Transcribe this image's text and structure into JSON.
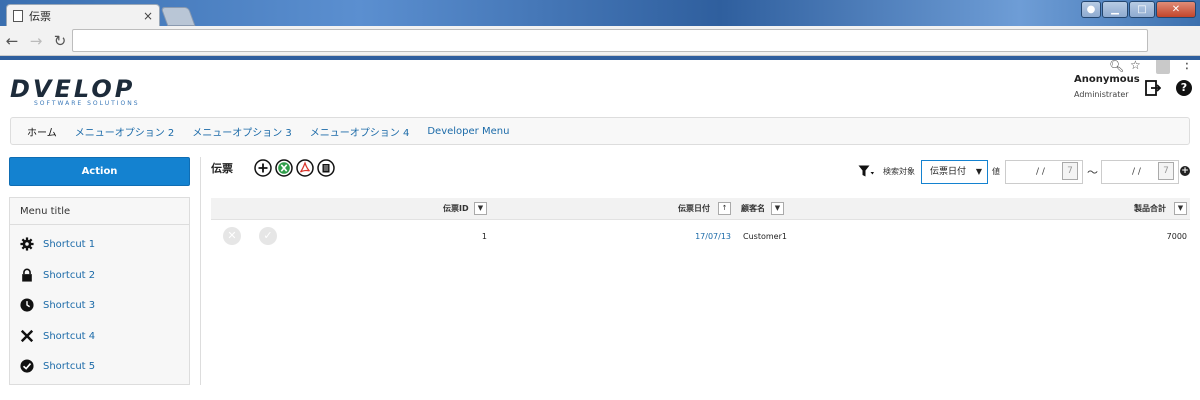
{
  "browser": {
    "tab_title": "伝票",
    "tab_close": "×",
    "url": ""
  },
  "brand": {
    "logo_text": "DVELOP",
    "logo_sub": "SOFTWARE SOLUTIONS"
  },
  "user": {
    "name": "Anonymous",
    "role": "Administrater"
  },
  "menu": [
    {
      "label": "ホーム"
    },
    {
      "label": "メニューオプション 2"
    },
    {
      "label": "メニューオプション 3"
    },
    {
      "label": "メニューオプション 4"
    },
    {
      "label": "Developer Menu"
    }
  ],
  "sidebar": {
    "action_label": "Action",
    "menu_title": "Menu title",
    "shortcuts": [
      {
        "label": "Shortcut 1",
        "icon": "gear-icon"
      },
      {
        "label": "Shortcut 2",
        "icon": "lock-icon"
      },
      {
        "label": "Shortcut 3",
        "icon": "clock-icon"
      },
      {
        "label": "Shortcut 4",
        "icon": "x-icon"
      },
      {
        "label": "Shortcut 5",
        "icon": "check-circle-icon"
      }
    ]
  },
  "page": {
    "title": "伝票",
    "toolbar_icons": [
      "add-circle-icon",
      "excel-icon",
      "pdf-icon",
      "document-icon"
    ]
  },
  "search": {
    "label": "検索対象",
    "selected": "伝票日付",
    "value_label": "値",
    "date_from": "/ /",
    "date_to": "/ /",
    "tilde": "～"
  },
  "grid": {
    "columns": [
      {
        "label": "伝票ID"
      },
      {
        "label": "伝票日付"
      },
      {
        "label": "顧客名"
      },
      {
        "label": "製品合計"
      }
    ],
    "rows": [
      {
        "id": "1",
        "date": "17/07/13",
        "customer": "Customer1",
        "total": "7000"
      }
    ]
  },
  "colors": {
    "accent": "#1482d0",
    "link": "#1b6aa8",
    "browser_blue": "#2f5f9e"
  }
}
